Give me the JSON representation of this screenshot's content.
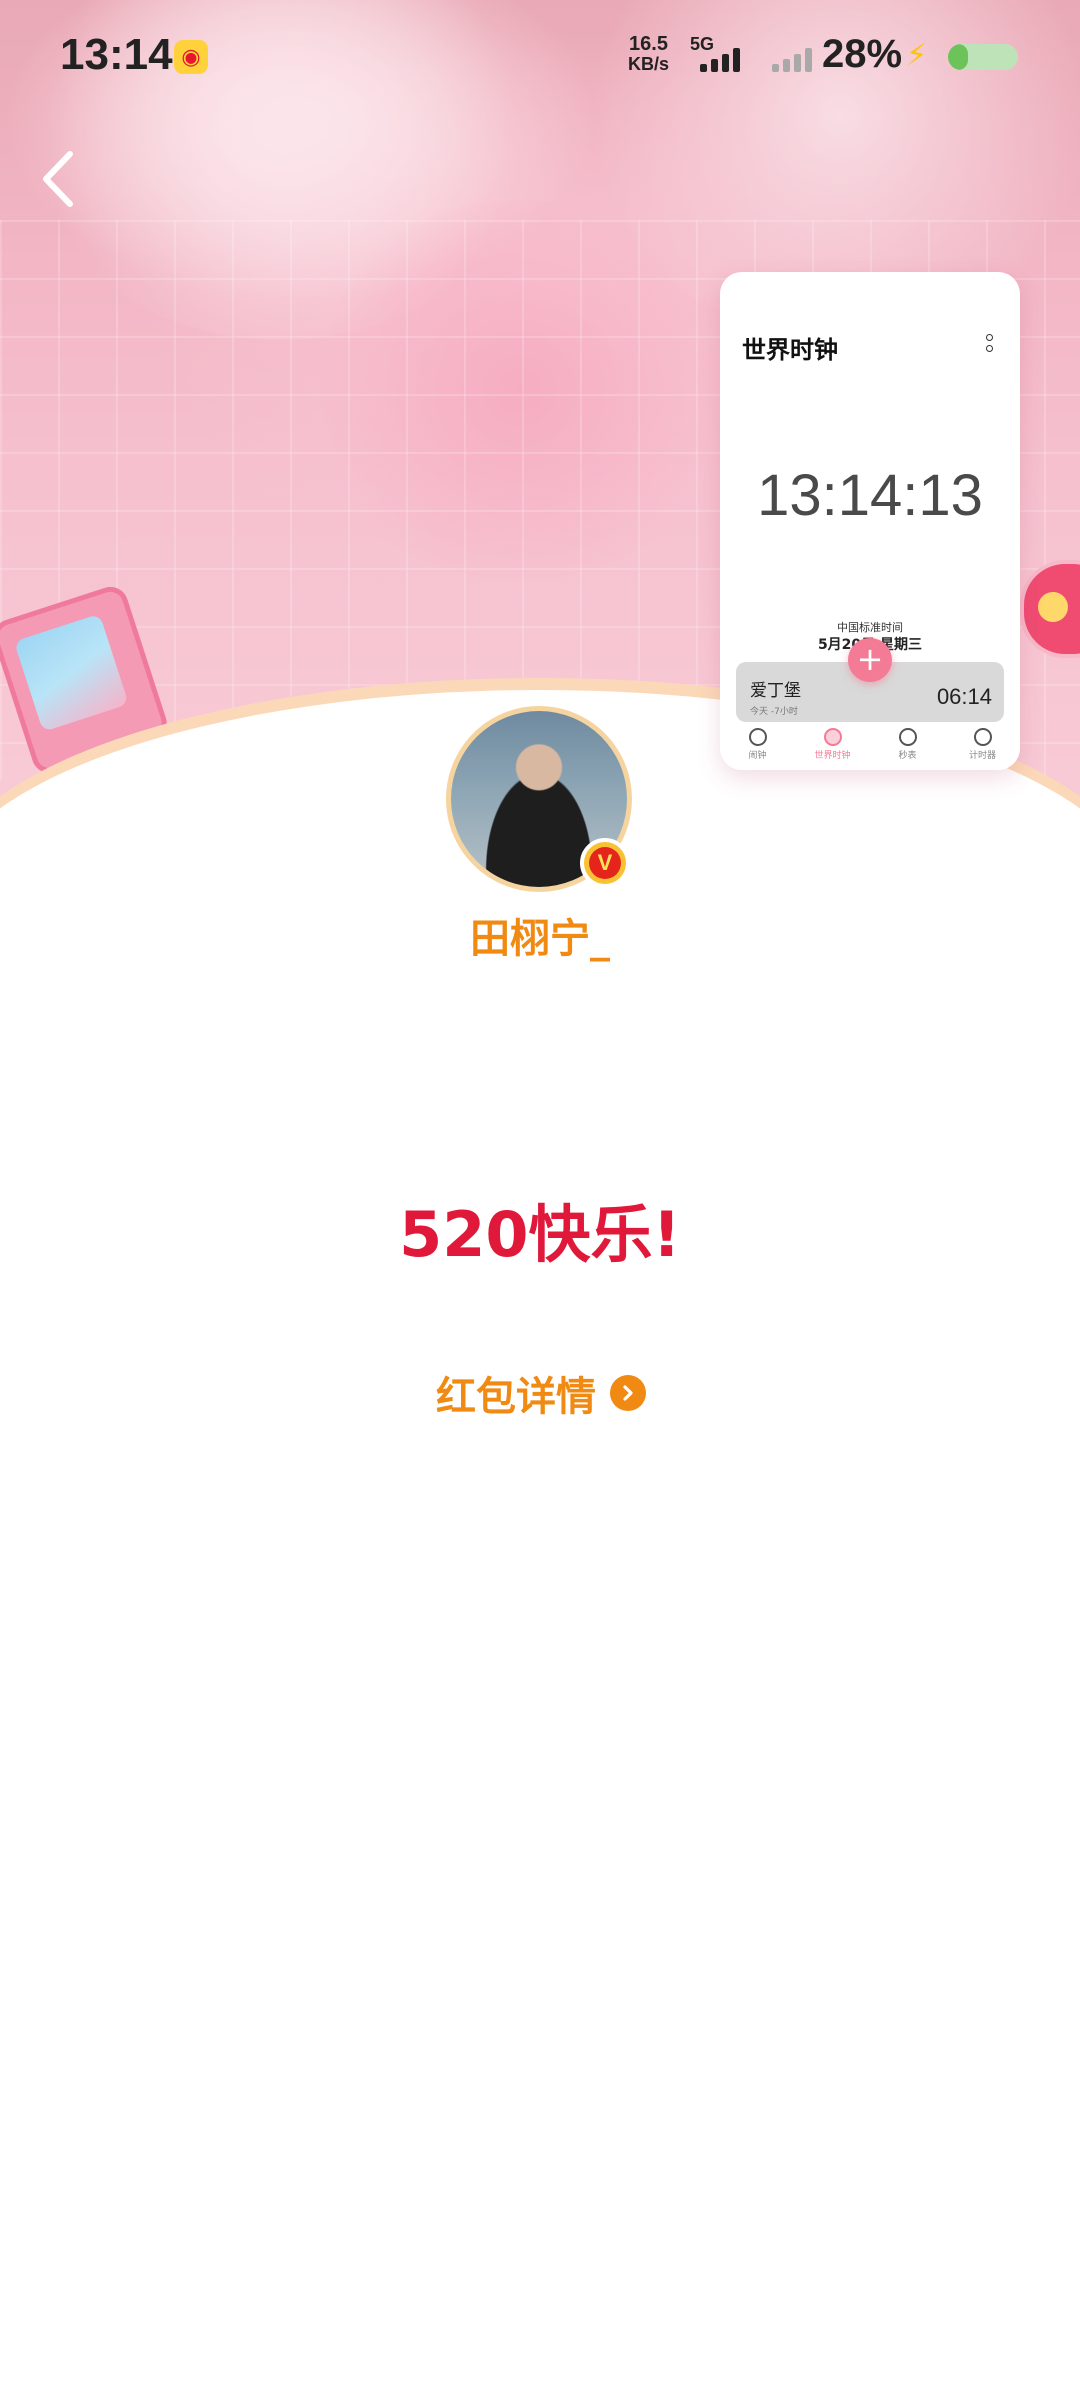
{
  "status_bar": {
    "time": "13:14",
    "network_speed_value": "16.5",
    "network_speed_unit": "KB/s",
    "network_type": "5G",
    "battery_percent": "28%",
    "battery_level": 0.28
  },
  "world_clock_pip": {
    "title": "世界时钟",
    "clock_time": "13:14:13",
    "zone_label": "中国标准时间",
    "date_label": "5月20日 星期三",
    "city_card": {
      "city": "爱丁堡",
      "offset": "今天 -7小时",
      "time": "06:14"
    },
    "tabs": [
      "闹钟",
      "世界时钟",
      "秒表",
      "计时器"
    ],
    "active_tab": "世界时钟"
  },
  "profile": {
    "username": "田栩宁_",
    "verified": true
  },
  "message": "520快乐!",
  "details_link": "红包详情",
  "colors": {
    "accent_orange": "#f08a12",
    "greeting_red": "#e0183a",
    "pip_accent_pink": "#f47b96"
  }
}
